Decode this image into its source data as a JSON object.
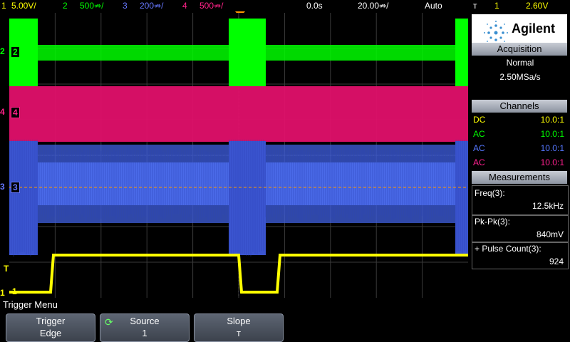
{
  "topbar": {
    "ch1_num": "1",
    "ch1_scale": "5.00V/",
    "ch2_num": "2",
    "ch2_scale": "500⇏/",
    "ch3_num": "3",
    "ch3_scale": "200⇏/",
    "ch4_num": "4",
    "ch4_scale": "500⇏/",
    "time_pos": "0.0s",
    "time_scale": "20.00⇏/",
    "trigger_mode": "Auto",
    "trigger_slope_icon": "т",
    "trigger_source": "1",
    "trigger_level": "2.60V"
  },
  "channels_markers": {
    "ch2": "2",
    "ch4": "4",
    "ch3": "3",
    "ch1": "1",
    "trigger": "T"
  },
  "panel": {
    "brand": "Agilent",
    "acquisition_header": "Acquisition",
    "acq_mode": "Normal",
    "acq_rate": "2.50MSa/s",
    "channels_header": "Channels",
    "channels": [
      {
        "coupling": "DC",
        "ratio": "10.0:1",
        "color": "#ffff00"
      },
      {
        "coupling": "AC",
        "ratio": "10.0:1",
        "color": "#00ff00"
      },
      {
        "coupling": "AC",
        "ratio": "10.0:1",
        "color": "#5577ff"
      },
      {
        "coupling": "AC",
        "ratio": "10.0:1",
        "color": "#ff2090"
      }
    ],
    "measurements_header": "Measurements",
    "measurements": [
      {
        "label": "Freq(3):",
        "value": "12.5kHz"
      },
      {
        "label": "Pk-Pk(3):",
        "value": "840mV"
      },
      {
        "label": "+ Pulse Count(3):",
        "value": "924"
      }
    ]
  },
  "menu": {
    "title": "Trigger Menu",
    "softkeys": [
      {
        "line1": "Trigger",
        "line2": "Edge"
      },
      {
        "line1": "Source",
        "line2": "1"
      },
      {
        "line1": "Slope",
        "line2": "т"
      }
    ]
  },
  "colors": {
    "ch1": "#ffff00",
    "ch2": "#00ff00",
    "ch3": "#4060e0",
    "ch4": "#e0106a",
    "grid": "#3a3a3a"
  }
}
